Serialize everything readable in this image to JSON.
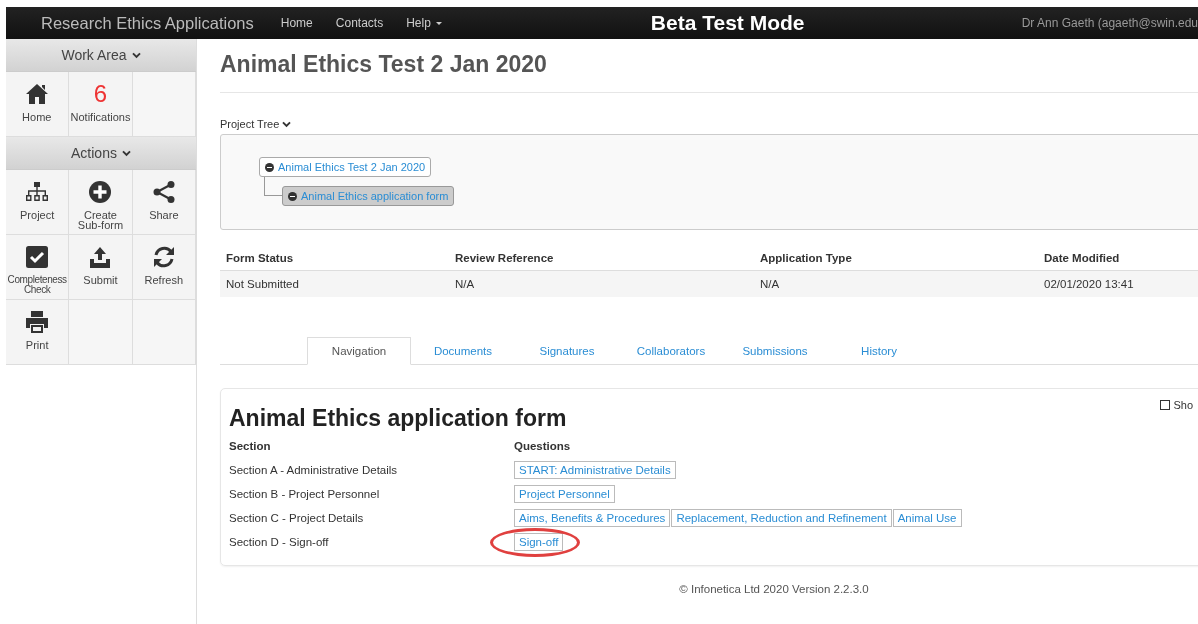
{
  "navbar": {
    "brand": "Research Ethics Applications",
    "links": [
      {
        "label": "Home",
        "dropdown": false
      },
      {
        "label": "Contacts",
        "dropdown": false
      },
      {
        "label": "Help",
        "dropdown": true
      }
    ],
    "mode": "Beta Test Mode",
    "user": "Dr Ann Gaeth (agaeth@swin.edu"
  },
  "sidebar": {
    "sections": [
      {
        "title": "Work Area",
        "tiles": [
          {
            "label": "Home"
          },
          {
            "label": "Notifications",
            "count": "6"
          }
        ]
      },
      {
        "title": "Actions",
        "tiles": [
          {
            "label": "Project"
          },
          {
            "label": "Create Sub-form"
          },
          {
            "label": "Share"
          },
          {
            "label": "Completeness Check"
          },
          {
            "label": "Submit"
          },
          {
            "label": "Refresh"
          },
          {
            "label": "Print"
          }
        ]
      }
    ]
  },
  "page_title": "Animal Ethics Test 2 Jan 2020",
  "project_tree": {
    "label": "Project Tree",
    "nodes": [
      {
        "label": "Animal Ethics Test 2 Jan 2020",
        "expanded": true,
        "selected": false,
        "children": [
          {
            "label": "Animal Ethics application form",
            "expanded": true,
            "selected": true
          }
        ]
      }
    ]
  },
  "summary": {
    "columns": [
      "Form Status",
      "Review Reference",
      "Application Type",
      "Date Modified"
    ],
    "rows": [
      [
        "Not Submitted",
        "N/A",
        "N/A",
        "02/01/2020 13:41"
      ]
    ]
  },
  "tabs": [
    {
      "label": "Navigation",
      "selected": true
    },
    {
      "label": "Documents",
      "selected": false
    },
    {
      "label": "Signatures",
      "selected": false
    },
    {
      "label": "Collaborators",
      "selected": false
    },
    {
      "label": "Submissions",
      "selected": false
    },
    {
      "label": "History",
      "selected": false
    }
  ],
  "form": {
    "show_toggle": {
      "label": "Sho",
      "checked": false
    },
    "title": "Animal Ethics application form",
    "columns": [
      "Section",
      "Questions"
    ],
    "rows": [
      {
        "section": "Section A - Administrative Details",
        "questions": [
          {
            "label": "START: Administrative Details",
            "highlighted": false
          }
        ]
      },
      {
        "section": "Section B - Project Personnel",
        "questions": [
          {
            "label": "Project Personnel",
            "highlighted": false
          }
        ]
      },
      {
        "section": "Section C - Project Details",
        "questions": [
          {
            "label": "Aims, Benefits & Procedures",
            "highlighted": false
          },
          {
            "label": "Replacement, Reduction and Refinement",
            "highlighted": false
          },
          {
            "label": "Animal Use",
            "highlighted": false
          }
        ]
      },
      {
        "section": "Section D - Sign-off",
        "questions": [
          {
            "label": "Sign-off",
            "highlighted": true
          }
        ]
      }
    ]
  },
  "footer": "© Infonetica Ltd 2020 Version 2.2.3.0"
}
